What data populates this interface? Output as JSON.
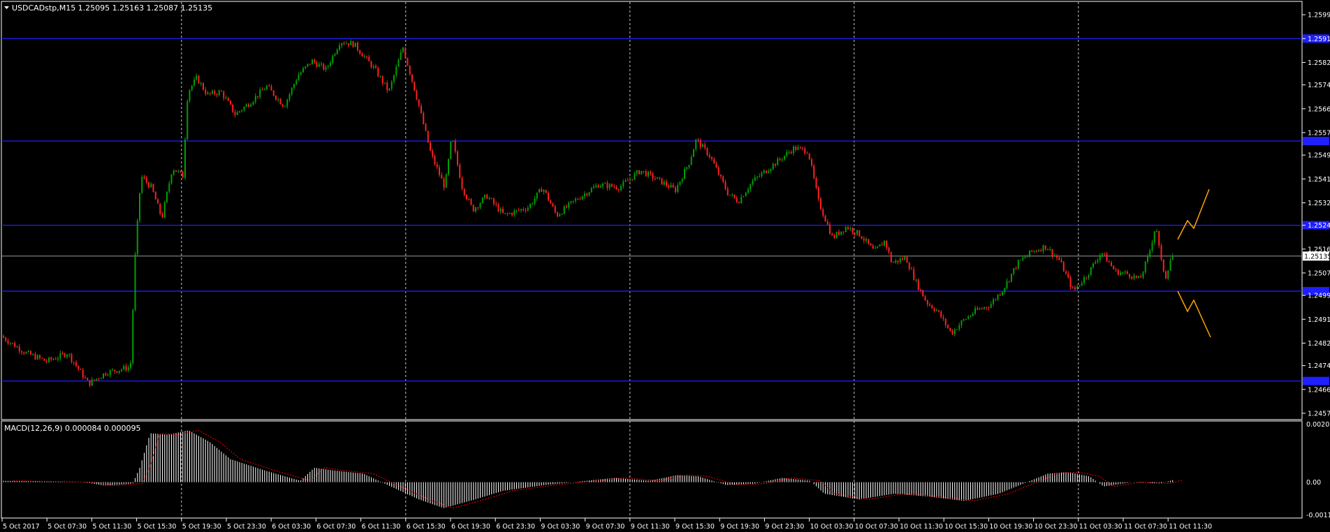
{
  "window": {
    "title": "USDCADstp,M15  1.25095 1.25163 1.25087 1.25135",
    "menu_arrow": "dropdown-arrow-icon"
  },
  "price_axis": {
    "labels": [
      "1.25995",
      "1.25910",
      "1.25825",
      "1.25745",
      "1.25660",
      "1.25575",
      "1.25495",
      "1.25410",
      "1.25325",
      "1.25245",
      "1.25160",
      "1.25075",
      "1.24995",
      "1.24910",
      "1.24825",
      "1.24745",
      "1.24660",
      "1.24575"
    ],
    "current_price": "1.25135",
    "range": [
      1.24555,
      1.2604
    ]
  },
  "time_axis": {
    "labels": [
      "5 Oct 2017",
      "5 Oct 07:30",
      "5 Oct 11:30",
      "5 Oct 15:30",
      "5 Oct 19:30",
      "5 Oct 23:30",
      "6 Oct 03:30",
      "6 Oct 07:30",
      "6 Oct 11:30",
      "6 Oct 15:30",
      "6 Oct 19:30",
      "6 Oct 23:30",
      "9 Oct 03:30",
      "9 Oct 07:30",
      "9 Oct 11:30",
      "9 Oct 15:30",
      "9 Oct 19:30",
      "9 Oct 23:30",
      "10 Oct 03:30",
      "10 Oct 07:30",
      "10 Oct 11:30",
      "10 Oct 15:30",
      "10 Oct 19:30",
      "10 Oct 23:30",
      "11 Oct 03:30",
      "11 Oct 07:30",
      "11 Oct 11:30"
    ]
  },
  "horizontal_levels": [
    1.2591,
    1.25545,
    1.25245,
    1.2501,
    1.2469
  ],
  "macd": {
    "title": "MACD(12,26,9) 0.000084 0.000095",
    "axis_labels": [
      "0.002014",
      "0.00",
      "-0.001133"
    ],
    "range": [
      -0.00122,
      0.0021
    ]
  },
  "colors": {
    "background": "#000000",
    "bull": "#00a000",
    "bear": "#ff2020",
    "level_line": "#1f1fff",
    "grid": "#c8c8c8",
    "macd_hist": "#ffffff",
    "macd_signal": "#ff0000",
    "projection": "#ffa500"
  }
}
